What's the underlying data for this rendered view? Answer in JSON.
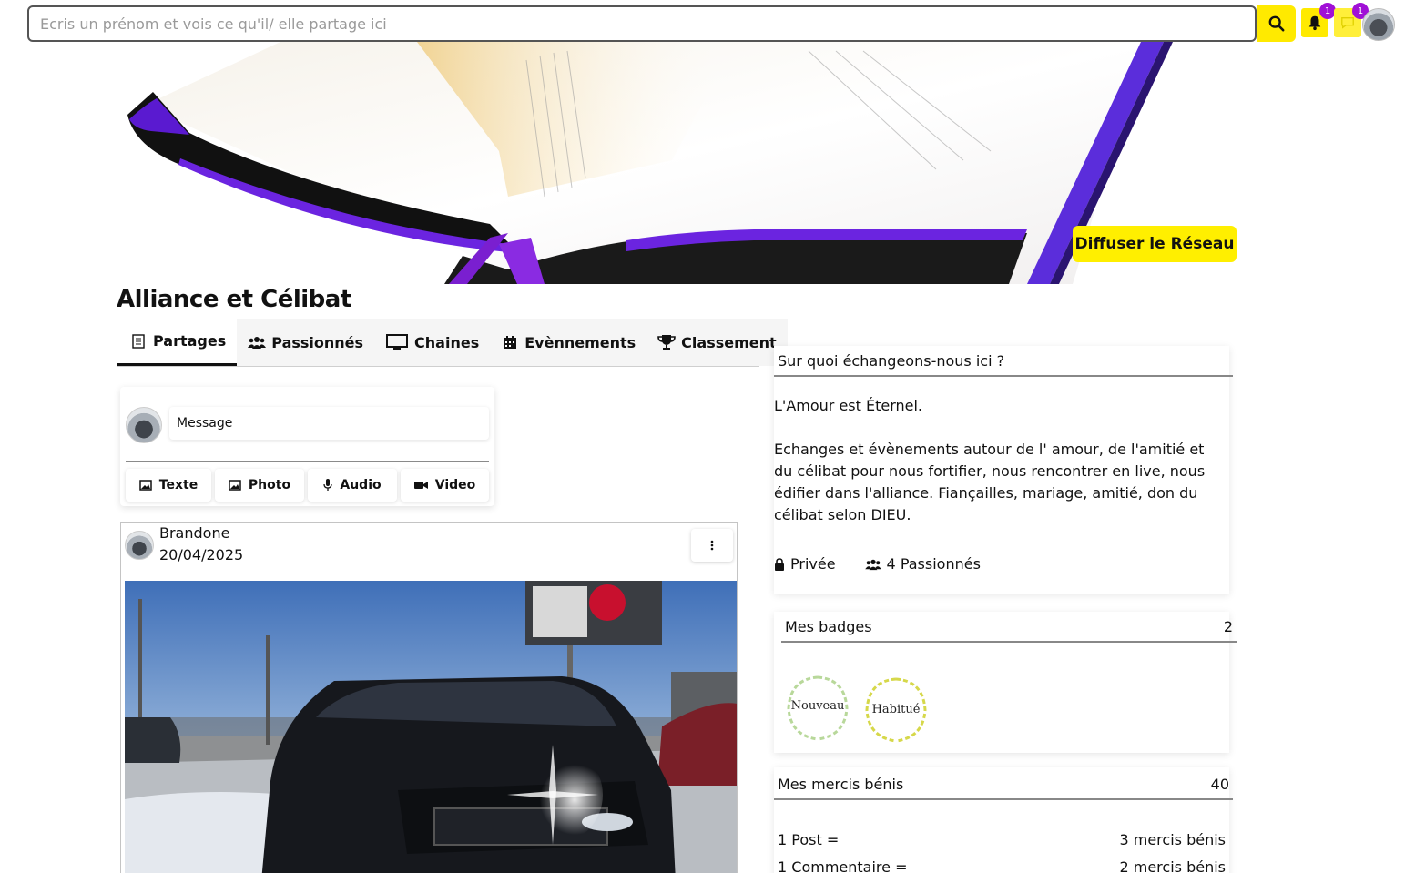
{
  "search": {
    "placeholder": "Ecris un prénom et vois ce qu'il/ elle partage ici"
  },
  "notifications": {
    "bell_count": "1",
    "messages_count": "1"
  },
  "banner": {
    "button_label": "Diffuser le Réseau"
  },
  "page_title": "Alliance et Célibat",
  "tabs": [
    {
      "label": "Partages",
      "icon": "document-icon"
    },
    {
      "label": "Passionnés",
      "icon": "users-icon"
    },
    {
      "label": "Chaines",
      "icon": "monitor-icon"
    },
    {
      "label": "Evènnements",
      "icon": "calendar-icon"
    },
    {
      "label": "Classement",
      "icon": "trophy-icon"
    }
  ],
  "composer": {
    "placeholder": "Message",
    "buttons": [
      {
        "label": "Texte",
        "icon": "image-icon"
      },
      {
        "label": "Photo",
        "icon": "image-icon"
      },
      {
        "label": "Audio",
        "icon": "microphone-icon"
      },
      {
        "label": "Video",
        "icon": "video-camera-icon"
      }
    ]
  },
  "post": {
    "author": "Brandone",
    "date": "20/04/2025"
  },
  "about": {
    "heading": "Sur quoi échangeons-nous ici ?",
    "line1": "L'Amour est Éternel.",
    "line2": "Echanges et évènements autour de l' amour, de l'amitié et du célibat pour nous fortifier, nous rencontrer en live, nous édifier dans l'alliance. Fiançailles, mariage, amitié, don du célibat selon DIEU.",
    "privacy": "Privée",
    "members": "4 Passionnés"
  },
  "badges": {
    "heading": "Mes badges",
    "count": "2",
    "items": [
      {
        "label": "Nouveau"
      },
      {
        "label": "Habitué"
      }
    ]
  },
  "merci": {
    "heading": "Mes mercis bénis",
    "count": "40",
    "rows": [
      {
        "label": "1 Post =",
        "value": "3 mercis bénis"
      },
      {
        "label": "1 Commentaire =",
        "value": "2 mercis bénis"
      }
    ]
  },
  "colors": {
    "accent_yellow": "#ffea00",
    "badge_purple": "#a010d6",
    "banner_purple": "#5a1ad0"
  }
}
